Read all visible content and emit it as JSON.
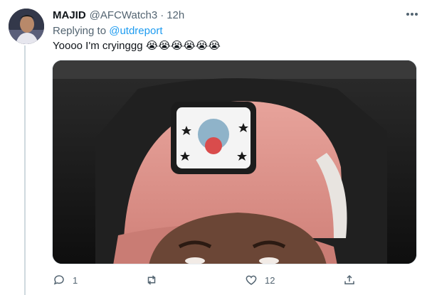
{
  "tweet": {
    "author_name": "MAJID",
    "author_handle": "@AFCWatch3",
    "separator": "·",
    "time": "12h",
    "replying_to_prefix": "Replying to",
    "replying_to_handle": "@utdreport",
    "text": "Yoooo I'm cryinggg 😭😭😭😭😭😭",
    "avatar_icon": "profile-photo",
    "media_description_icon": "photo-attachment"
  },
  "actions": {
    "reply_count": "1",
    "retweet_count": "",
    "like_count": "12",
    "share_count": ""
  },
  "colors": {
    "link": "#1d9bf0",
    "muted": "#536471",
    "text": "#0f1419",
    "thread_line": "#cfd9de"
  }
}
